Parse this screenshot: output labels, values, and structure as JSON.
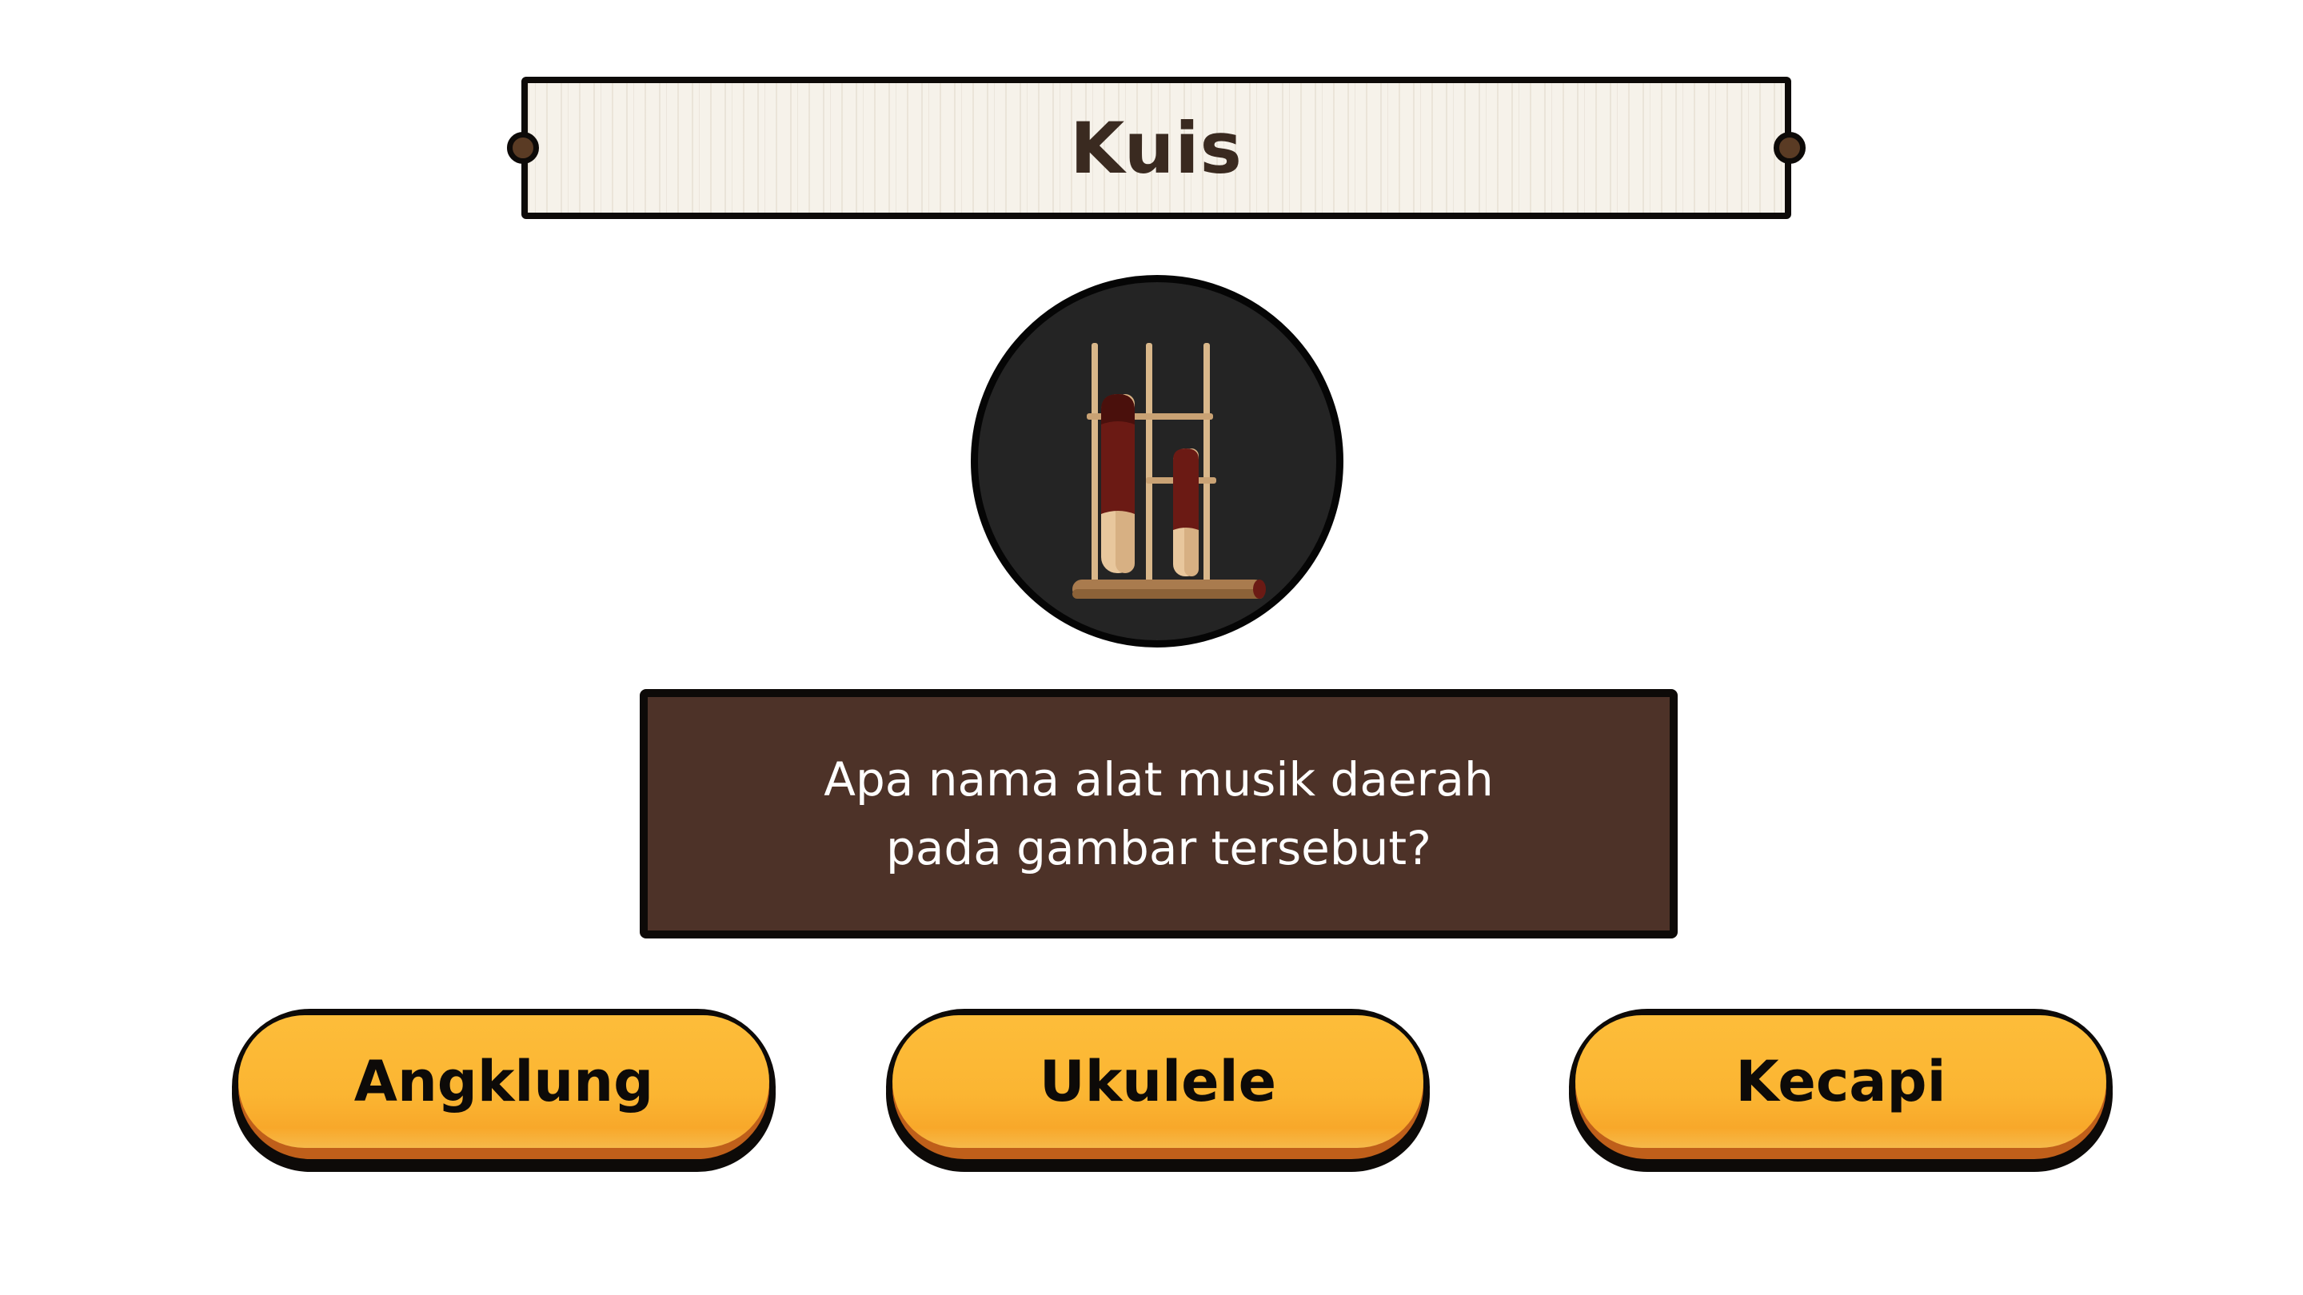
{
  "header": {
    "title": "Kuis"
  },
  "question": {
    "image_icon": "angklung-icon",
    "text": "Apa nama alat musik daerah pada gambar tersebut?"
  },
  "answers": [
    {
      "label": "Angklung"
    },
    {
      "label": "Ukulele"
    },
    {
      "label": "Kecapi"
    }
  ],
  "colors": {
    "plank": "#f6f2ea",
    "title_text": "#3a2a20",
    "circle_bg": "#242424",
    "question_bg": "#4d3228",
    "button_face": "#fbb532",
    "button_rim": "#bf5f1a",
    "outline": "#0d0a08"
  }
}
